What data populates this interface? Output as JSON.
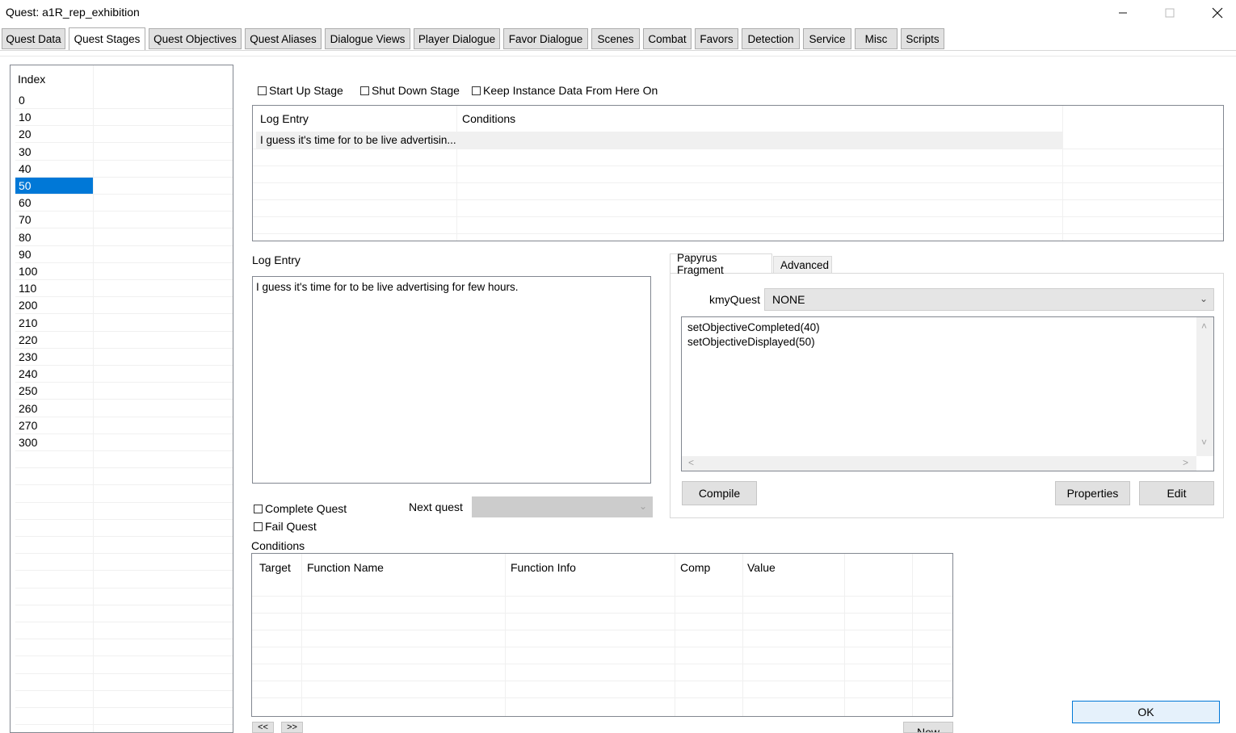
{
  "window": {
    "title": "Quest: a1R_rep_exhibition",
    "minimize_glyph": "—",
    "maximize_glyph": "☐",
    "close_glyph": "✕"
  },
  "tabs": [
    {
      "label": "Quest Data"
    },
    {
      "label": "Quest Stages"
    },
    {
      "label": "Quest Objectives"
    },
    {
      "label": "Quest Aliases"
    },
    {
      "label": "Dialogue Views"
    },
    {
      "label": "Player Dialogue"
    },
    {
      "label": "Favor Dialogue"
    },
    {
      "label": "Scenes"
    },
    {
      "label": "Combat"
    },
    {
      "label": "Favors"
    },
    {
      "label": "Detection"
    },
    {
      "label": "Service"
    },
    {
      "label": "Misc"
    },
    {
      "label": "Scripts"
    }
  ],
  "active_tab": "Quest Stages",
  "stage_list": {
    "header": "Index",
    "selected": "50",
    "items": [
      "0",
      "10",
      "20",
      "30",
      "40",
      "50",
      "60",
      "70",
      "80",
      "90",
      "100",
      "110",
      "200",
      "210",
      "220",
      "230",
      "240",
      "250",
      "260",
      "270",
      "300"
    ]
  },
  "stage_flags": {
    "start_up": "Start Up Stage",
    "shut_down": "Shut Down Stage",
    "keep_instance": "Keep Instance Data From Here On"
  },
  "log_table": {
    "headers": [
      "Log Entry",
      "Conditions"
    ],
    "rows": [
      {
        "log_entry": "I guess it's time for to be live advertisin...",
        "conditions": ""
      }
    ]
  },
  "log_entry": {
    "label": "Log Entry",
    "text": "I guess it's time for to be live advertising for few hours."
  },
  "quest_flags": {
    "complete": "Complete Quest",
    "fail": "Fail Quest"
  },
  "next_quest": {
    "label": "Next quest",
    "value": ""
  },
  "fragment_panel": {
    "tabs": [
      "Papyrus Fragment",
      "Advanced"
    ],
    "active_tab": "Papyrus Fragment",
    "property_label": "kmyQuest",
    "property_value": "NONE",
    "code_lines": [
      "setObjectiveCompleted(40)",
      "setObjectiveDisplayed(50)"
    ],
    "buttons": {
      "compile": "Compile",
      "properties": "Properties",
      "edit": "Edit"
    }
  },
  "conditions": {
    "label": "Conditions",
    "headers": [
      "Target",
      "Function Name",
      "Function Info",
      "Comp",
      "Value"
    ],
    "buttons": {
      "prev": "<<",
      "next": ">>",
      "new": "New"
    }
  },
  "ok_button": "OK",
  "icons": {
    "chevron_down": "⌄",
    "arrow_up": "˄",
    "arrow_down": "˅",
    "arrow_left": "<",
    "arrow_right": ">"
  }
}
